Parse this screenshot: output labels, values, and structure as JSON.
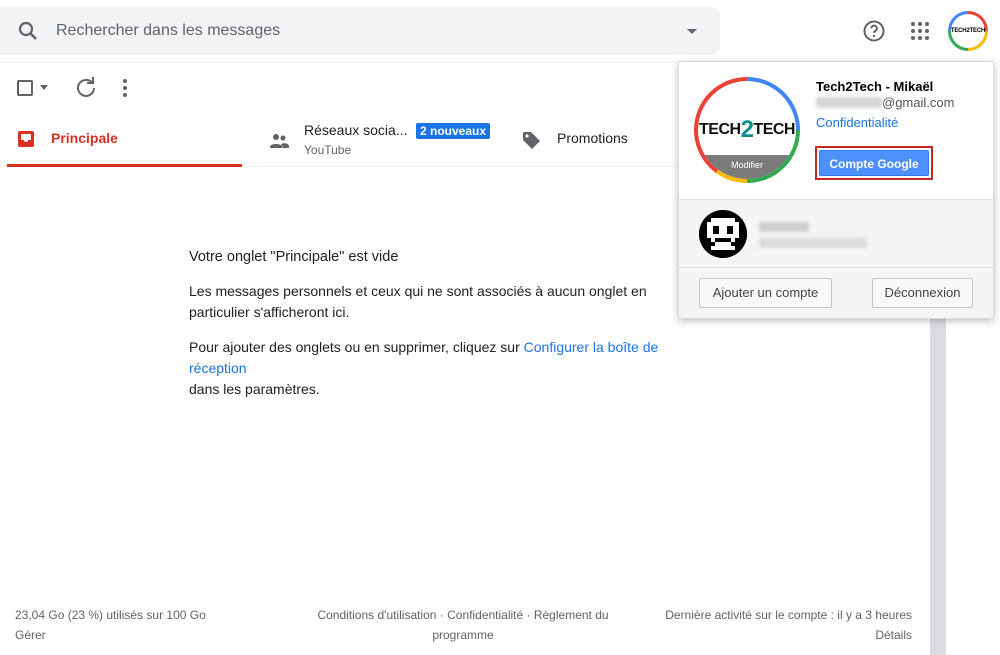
{
  "search": {
    "placeholder": "Rechercher dans les messages"
  },
  "header": {
    "avatar_text": "TECH2TECH"
  },
  "tabs": [
    {
      "label": "Principale",
      "active": true
    },
    {
      "label": "Réseaux socia...",
      "sub": "YouTube",
      "badge": "2 nouveaux"
    },
    {
      "label": "Promotions"
    }
  ],
  "empty_state": {
    "title": "Votre onglet \"Principale\" est vide",
    "text1": "Les messages personnels et ceux qui ne sont associés à aucun onglet en particulier s'afficheront ici.",
    "text2_prefix": "Pour ajouter des onglets ou en supprimer, cliquez sur ",
    "text2_link": "Configurer la boîte de réception",
    "text2_suffix": "dans les paramètres."
  },
  "footer": {
    "storage": "23,04 Go (23 %) utilisés sur 100 Go",
    "manage": "Gérer",
    "terms": "Conditions d'utilisation · Confidentialité · Règlement du programme",
    "activity": "Dernière activité sur le compte : il y a 3 heures",
    "details": "Détails"
  },
  "popup": {
    "name": "Tech2Tech - Mikaël",
    "email_suffix": "@gmail.com",
    "privacy": "Confidentialité",
    "google_account": "Compte Google",
    "modify": "Modifier",
    "logo_left": "TECH",
    "logo_two": "2",
    "logo_right": "TECH",
    "add_account": "Ajouter un compte",
    "logout": "Déconnexion"
  },
  "colors": {
    "accent_red": "#d93025",
    "link_blue": "#1a73e8",
    "badge_blue": "#1a73e8",
    "google_btn": "#4d90fe"
  }
}
